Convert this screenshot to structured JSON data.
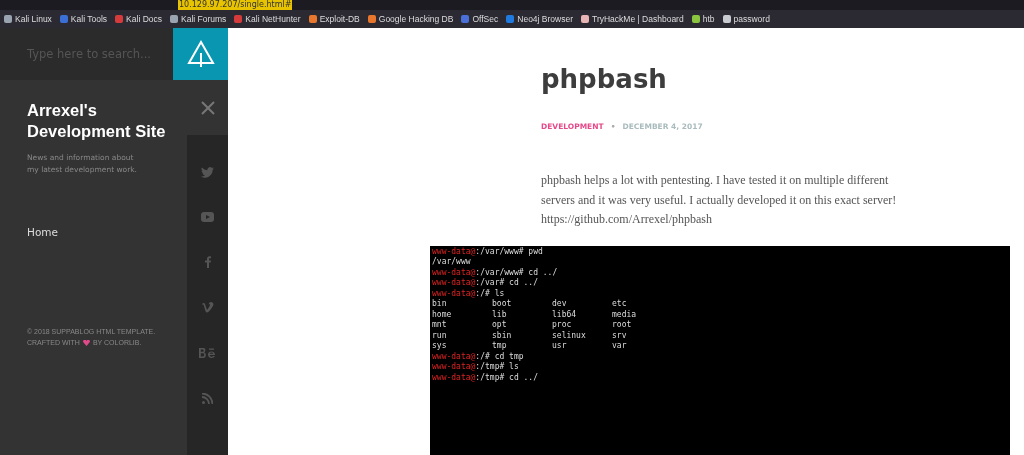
{
  "browser": {
    "url": "10.129.97.207/single.html#",
    "bookmarks": [
      {
        "label": "Kali Linux",
        "color": "#9aa4b0"
      },
      {
        "label": "Kali Tools",
        "color": "#3b6fd6"
      },
      {
        "label": "Kali Docs",
        "color": "#d63b3b"
      },
      {
        "label": "Kali Forums",
        "color": "#9aa4b0"
      },
      {
        "label": "Kali NetHunter",
        "color": "#d63b3b"
      },
      {
        "label": "Exploit-DB",
        "color": "#e8762c"
      },
      {
        "label": "Google Hacking DB",
        "color": "#e8762c"
      },
      {
        "label": "OffSec",
        "color": "#4a6fd8"
      },
      {
        "label": "Neo4j Browser",
        "color": "#1f7be0"
      },
      {
        "label": "TryHackMe | Dashboard",
        "color": "#e8b4b4"
      },
      {
        "label": "htb",
        "color": "#8bc53f"
      },
      {
        "label": "password",
        "color": "#c8cbd0"
      }
    ]
  },
  "sidebar": {
    "search_placeholder": "Type here to search...",
    "site_title": "Arrexel's Development Site",
    "tagline": "News and information about my latest development work.",
    "nav": [
      {
        "label": "Home"
      }
    ],
    "footer_line1": "© 2018 SUPPABLOG HTML TEMPLATE.",
    "footer_crafted": "CRAFTED WITH",
    "footer_by": "BY COLORLIB."
  },
  "post": {
    "title": "phpbash",
    "category": "DEVELOPMENT",
    "separator": "•",
    "date": "DECEMBER 4, 2017",
    "body": "phpbash helps a lot with pentesting. I have tested it on multiple different servers and it was very useful. I actually developed it on this exact server! https://github.com/Arrexel/phpbash",
    "terminal": {
      "lines_before": [
        {
          "prompt": "www-data@",
          "text": ":/var/www# pwd"
        },
        {
          "text": "/var/www"
        },
        {
          "prompt": "www-data@",
          "text": ":/var/www# cd ../"
        },
        {
          "prompt": "www-data@",
          "text": ":/var# cd ../"
        },
        {
          "prompt": "www-data@",
          "text": ":/# ls"
        }
      ],
      "listing": [
        "bin",
        "boot",
        "dev",
        "etc",
        "home",
        "lib",
        "lib64",
        "media",
        "mnt",
        "opt",
        "proc",
        "root",
        "run",
        "sbin",
        "selinux",
        "srv",
        "sys",
        "tmp",
        "usr",
        "var"
      ],
      "lines_after": [
        {
          "prompt": "www-data@",
          "text": ":/# cd tmp"
        },
        {
          "prompt": "www-data@",
          "text": ":/tmp# ls"
        },
        {
          "prompt": "www-data@",
          "text": ":/tmp# cd ../"
        }
      ]
    }
  }
}
